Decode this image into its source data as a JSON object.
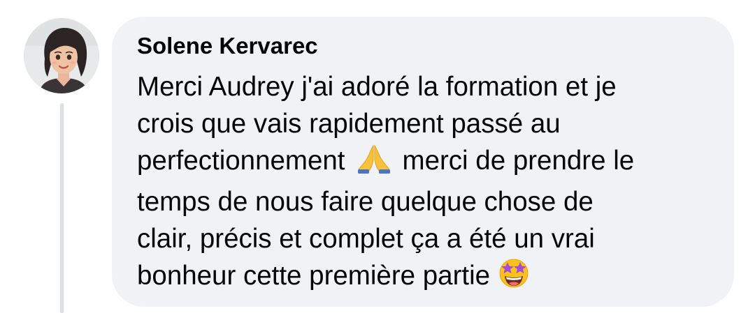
{
  "comment": {
    "author": "Solene Kervarec",
    "lines": [
      "Merci Audrey j'ai adoré la formation et je",
      "crois que vais rapidement passé au",
      "perfectionnement",
      "merci de prendre le",
      "temps de nous faire quelque chose de",
      "clair, précis et complet ça a été un vrai",
      "bonheur cette première partie"
    ],
    "emojis": [
      "folded-hands",
      "star-struck"
    ]
  },
  "colors": {
    "bubble": "#f0f2f5",
    "text": "#050505",
    "thread_line": "#dcdfe3"
  }
}
